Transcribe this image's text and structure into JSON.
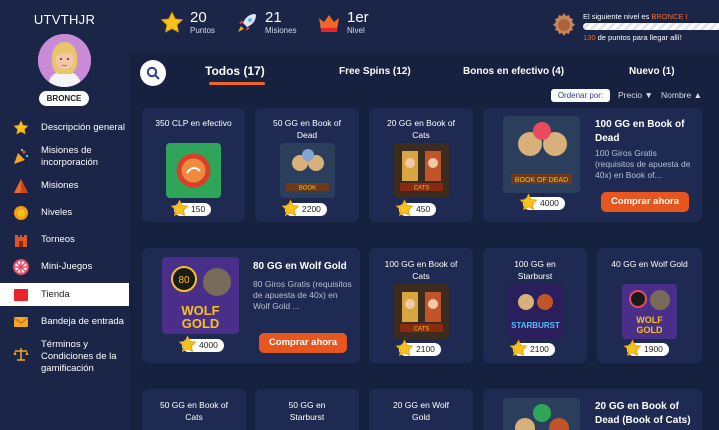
{
  "user": {
    "name": "UTVTHJR",
    "rank": "BRONCE"
  },
  "nav": [
    {
      "label": "Descripción general",
      "icon": "star-icon"
    },
    {
      "label": "Misiones de incorporación",
      "icon": "confetti-icon"
    },
    {
      "label": "Misiones",
      "icon": "pyramid-icon"
    },
    {
      "label": "Niveles",
      "icon": "sun-medal-icon"
    },
    {
      "label": "Torneos",
      "icon": "castle-icon"
    },
    {
      "label": "Mini-Juegos",
      "icon": "wheel-icon"
    },
    {
      "label": "Tienda",
      "icon": "shop-icon"
    },
    {
      "label": "Bandeja de entrada",
      "icon": "envelope-icon"
    },
    {
      "label": "Términos y Condiciones de la gamificación",
      "icon": "scales-icon"
    }
  ],
  "stats": {
    "points": {
      "value": "20",
      "label": "Puntos"
    },
    "missions": {
      "value": "21",
      "label": "Misiones"
    },
    "level": {
      "value": "1er",
      "label": "Nivel"
    }
  },
  "next_level": {
    "prefix": "El siguiente nivel es ",
    "level": "BRONCE I",
    "points_needed": "130",
    "suffix": " de puntos para llegar allí!"
  },
  "tabs": [
    {
      "label": "Todos (17)"
    },
    {
      "label": "Free Spins (12)"
    },
    {
      "label": "Bonos en efectivo (4)"
    },
    {
      "label": "Nuevo (1)"
    }
  ],
  "sort": {
    "label": "Ordenar por:",
    "price": "Precio ▼",
    "name": "Nombre ▲"
  },
  "buy_label": "Comprar ahora",
  "products": {
    "p1": {
      "title": "350 CLP en efectivo",
      "price": "150"
    },
    "p2": {
      "title": "50 GG en Book of Dead",
      "price": "2200"
    },
    "p3": {
      "title": "20 GG en Book of Cats",
      "price": "450"
    },
    "p4": {
      "title": "100 GG en Book of Dead",
      "desc": "100 Giros Gratis (requisitos de apuesta de 40x) en Book of...",
      "price": "4000"
    },
    "p5": {
      "title": "80 GG en Wolf Gold",
      "desc": "80 Giros Gratis (requisitos de apuesta de 40x) en Wolf Gold ...",
      "price": "4000"
    },
    "p6": {
      "title": "100 GG en Book of Cats",
      "price": "2100"
    },
    "p7": {
      "title": "100 GG en Starburst",
      "price": "2100"
    },
    "p8": {
      "title": "40 GG en Wolf Gold",
      "price": "1900"
    },
    "p9": {
      "title": "50 GG en Book of Cats"
    },
    "p10": {
      "title": "50 GG en Starburst"
    },
    "p11": {
      "title": "20 GG en Wolf Gold"
    },
    "p12": {
      "title": "20 GG en Book of Dead (Book of Cats)"
    }
  }
}
